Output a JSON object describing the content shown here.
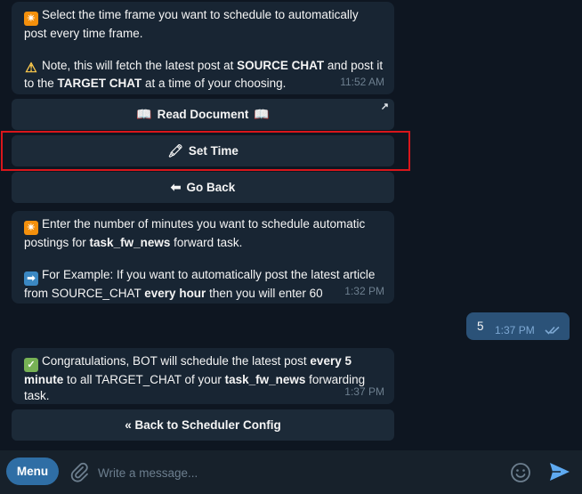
{
  "messages": {
    "msg1": {
      "line1_emoji": "✴",
      "line1": "Select the time frame you want to schedule to automatically post every time frame.",
      "line2_emoji": "⚠",
      "line2_a": "Note, this will fetch the latest post at ",
      "line2_b": "SOURCE CHAT",
      "line2_c": " and post it to the ",
      "line2_d": "TARGET CHAT",
      "line2_e": " at a time of your choosing.",
      "time": "11:52 AM"
    },
    "msg2": {
      "line1_emoji": "✴",
      "line1_a": "Enter the number of minutes you want to schedule automatic postings for ",
      "line1_b": "task_fw_news",
      "line1_c": " forward task.",
      "line2_emoji": "➡",
      "line2_a": "For Example: If you want to automatically post the latest article from SOURCE_CHAT ",
      "line2_b": "every hour",
      "line2_c": " then you will enter 60",
      "time": "1:32 PM"
    },
    "outgoing": {
      "text": "5",
      "time": "1:37 PM"
    },
    "msg3": {
      "emoji": "✓",
      "a": "Congratulations, BOT will schedule the latest post ",
      "b": "every 5 minute",
      "c": " to all TARGET_CHAT of your ",
      "d": "task_fw_news",
      "e": " forwarding task.",
      "time": "1:37 PM"
    }
  },
  "keyboard1": {
    "read_doc": {
      "icon": "📖",
      "label": "Read Document",
      "icon2": "📖",
      "corner": "↗"
    },
    "set_time": {
      "icon": "🖍",
      "label": "Set Time"
    },
    "go_back": {
      "icon": "⬅",
      "label": "Go Back"
    }
  },
  "keyboard2": {
    "back_scheduler": {
      "label": "« Back to Scheduler Config"
    }
  },
  "bottom_bar": {
    "menu_label": "Menu",
    "placeholder": "Write a message..."
  },
  "colors": {
    "background": "#0e1621",
    "bubble_in": "#182533",
    "bubble_out": "#2b5278",
    "keyboard_button": "#1c2a38",
    "highlight": "#d9161b",
    "accent": "#2f6ea5"
  }
}
